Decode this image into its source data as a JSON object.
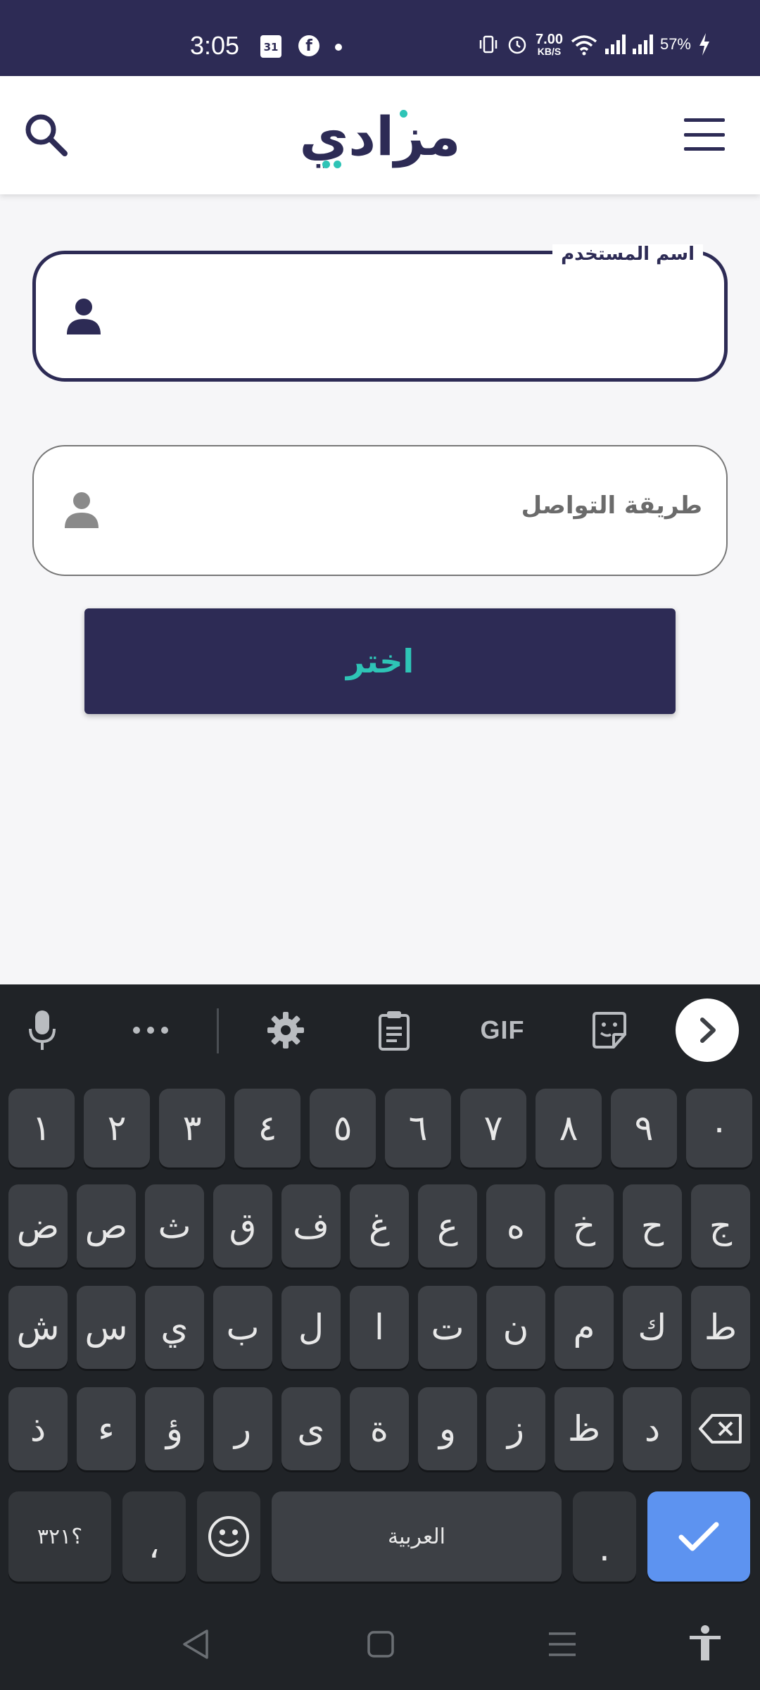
{
  "status_bar": {
    "time": "3:05",
    "calendar_day": "31",
    "facebook_glyph": "f",
    "net_speed_value": "7.00",
    "net_speed_unit": "KB/S",
    "battery": "57%"
  },
  "header": {
    "logo_text": "مزادي",
    "icons": [
      "search-icon",
      "menu-icon"
    ]
  },
  "form": {
    "username_label": "اسم المستخدم",
    "username_value": "",
    "contact_placeholder": "طريقة التواصل",
    "choose_button": "اختر"
  },
  "keyboard": {
    "toolbar": {
      "gif_label": "GIF",
      "icons": [
        "microphone-icon",
        "more-icon",
        "settings-icon",
        "clipboard-icon",
        "sticker-icon",
        "chevron-right-icon"
      ]
    },
    "row_numbers": [
      "١",
      "٢",
      "٣",
      "٤",
      "٥",
      "٦",
      "٧",
      "٨",
      "٩",
      "٠"
    ],
    "row1": [
      "ض",
      "ص",
      "ث",
      "ق",
      "ف",
      "غ",
      "ع",
      "ه",
      "خ",
      "ح",
      "ج"
    ],
    "row2": [
      "ش",
      "س",
      "ي",
      "ب",
      "ل",
      "ا",
      "ت",
      "ن",
      "م",
      "ك",
      "ط"
    ],
    "row3": [
      "ذ",
      "ء",
      "ؤ",
      "ر",
      "ى",
      "ة",
      "و",
      "ز",
      "ظ",
      "د"
    ],
    "symbols_key": "؟٣٢١",
    "comma_key": "،",
    "space_label": "العربية",
    "period_key": ".",
    "colors": {
      "background": "#202327",
      "key": "#3d4045",
      "enter": "#5d93f0"
    }
  },
  "colors": {
    "primary": "#2d2b55",
    "accent": "#2ec4b6",
    "page_background": "#f6f6f8"
  }
}
